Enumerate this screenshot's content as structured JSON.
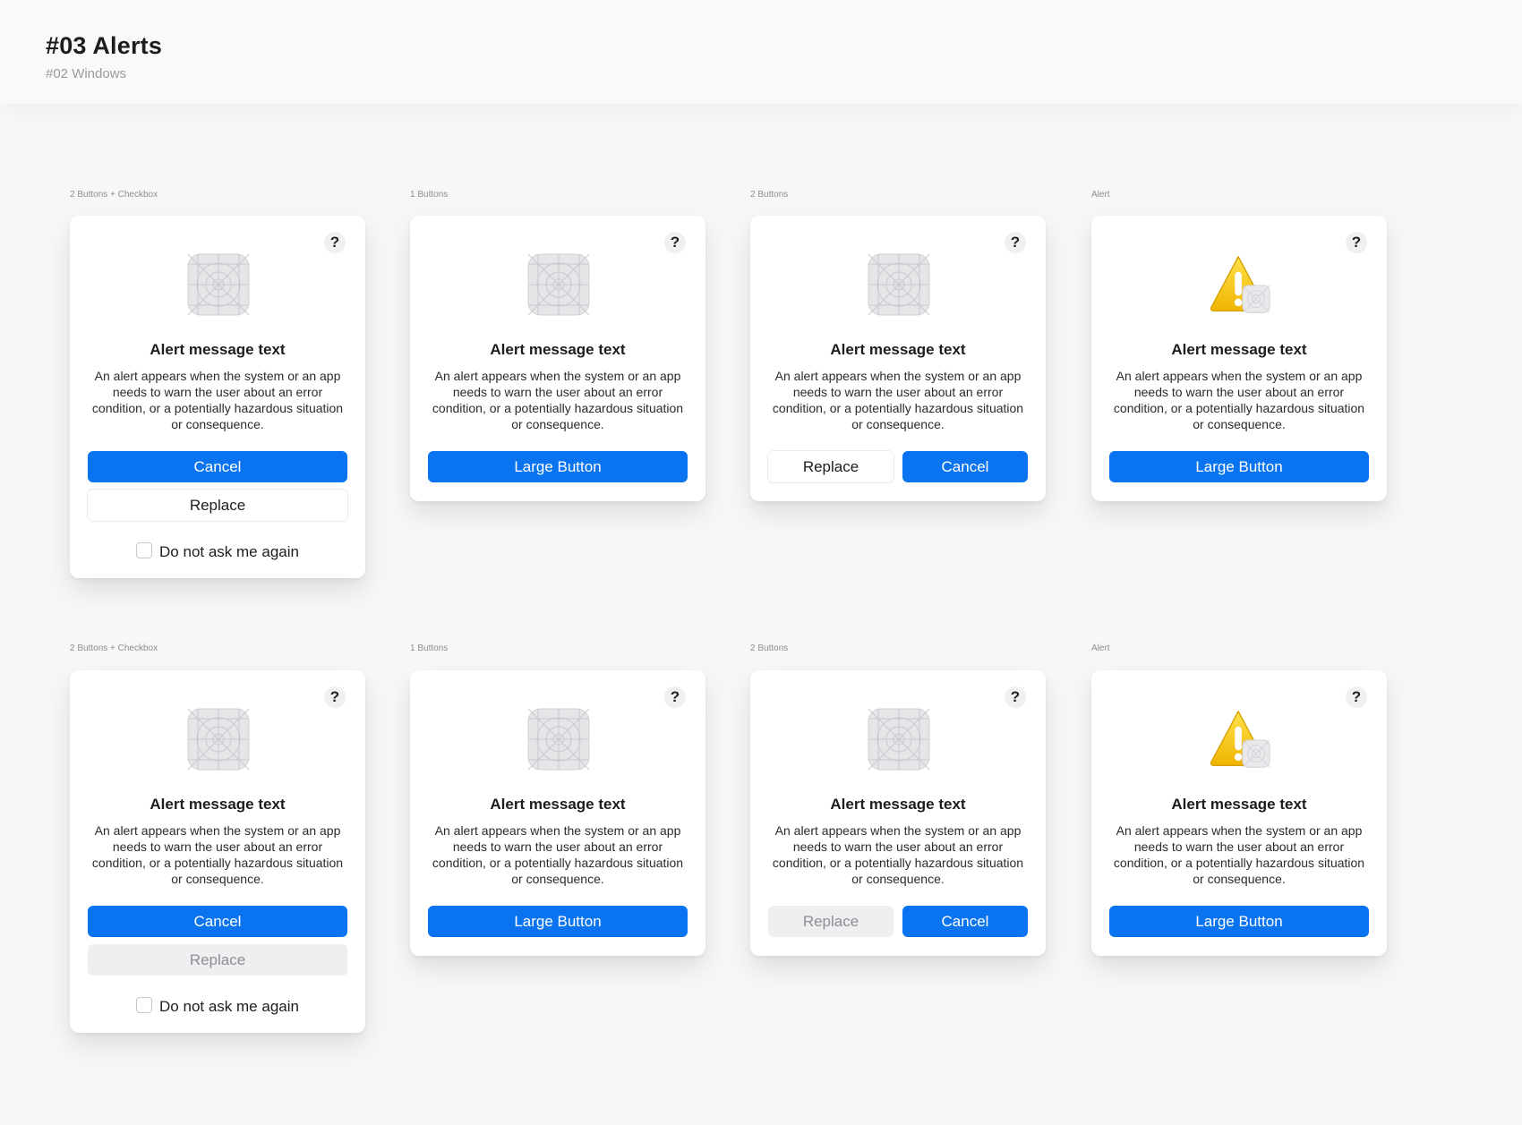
{
  "header": {
    "title": "#03 Alerts",
    "subtitle": "#02 Windows"
  },
  "colors": {
    "accent": "#0a74f0",
    "background": "#f7f7f8",
    "card": "#ffffff",
    "warning": "#f2c100"
  },
  "sections": [
    {
      "label": "2 Buttons + Checkbox"
    },
    {
      "label": "1 Buttons"
    },
    {
      "label": "2 Buttons"
    },
    {
      "label": "Alert"
    }
  ],
  "alert": {
    "help": "?",
    "title": "Alert message text",
    "body": "An alert appears when the system or an app needs to warn the user about an error condition, or a potentially hazardous situation or consequence."
  },
  "buttons": {
    "cancel": "Cancel",
    "replace": "Replace",
    "large": "Large Button"
  },
  "checkbox": {
    "label": "Do not ask me again",
    "checked": false
  },
  "icons": {
    "app": "app-icon-placeholder",
    "warning": "warning-triangle-icon",
    "help": "question-mark-icon"
  }
}
